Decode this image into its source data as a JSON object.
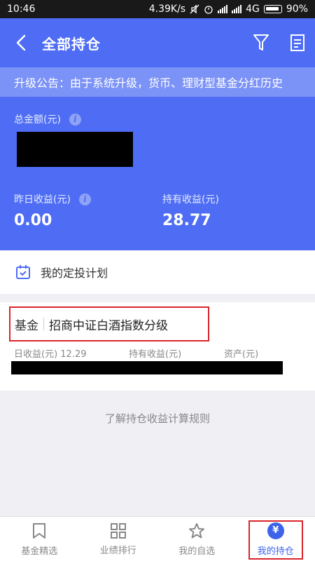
{
  "status_bar": {
    "time": "10:46",
    "speed": "4.39K/s",
    "network": "4G",
    "battery": "90%"
  },
  "nav": {
    "title": "全部持仓",
    "back_icon": "chevron-left-icon",
    "filter_icon": "filter-icon",
    "doc_icon": "document-icon"
  },
  "notice": {
    "text": "升级公告：由于系统升级，货币、理财型基金分红历史"
  },
  "summary": {
    "total_label": "总金额(元)",
    "yesterday_label": "昨日收益(元)",
    "yesterday_value": "0.00",
    "holding_label": "持有收益(元)",
    "holding_value": "28.77"
  },
  "plan": {
    "label": "我的定投计划",
    "icon": "calendar-icon"
  },
  "fund": {
    "type": "基金",
    "name": "招商中证白酒指数分级",
    "daily_label": "日收益(元) 12.29",
    "holding_label": "持有收益(元)",
    "asset_label": "资产(元)"
  },
  "rule_link": "了解持仓收益计算规则",
  "tabs": [
    {
      "label": "基金精选",
      "icon": "bookmark-icon"
    },
    {
      "label": "业绩排行",
      "icon": "grid-icon"
    },
    {
      "label": "我的自选",
      "icon": "star-icon"
    },
    {
      "label": "我的持仓",
      "icon": "yen-icon"
    }
  ],
  "colors": {
    "primary": "#4e6df4",
    "notice_bg": "#7b92f7",
    "highlight": "#d9252b",
    "tab_active": "#3d63ea"
  }
}
